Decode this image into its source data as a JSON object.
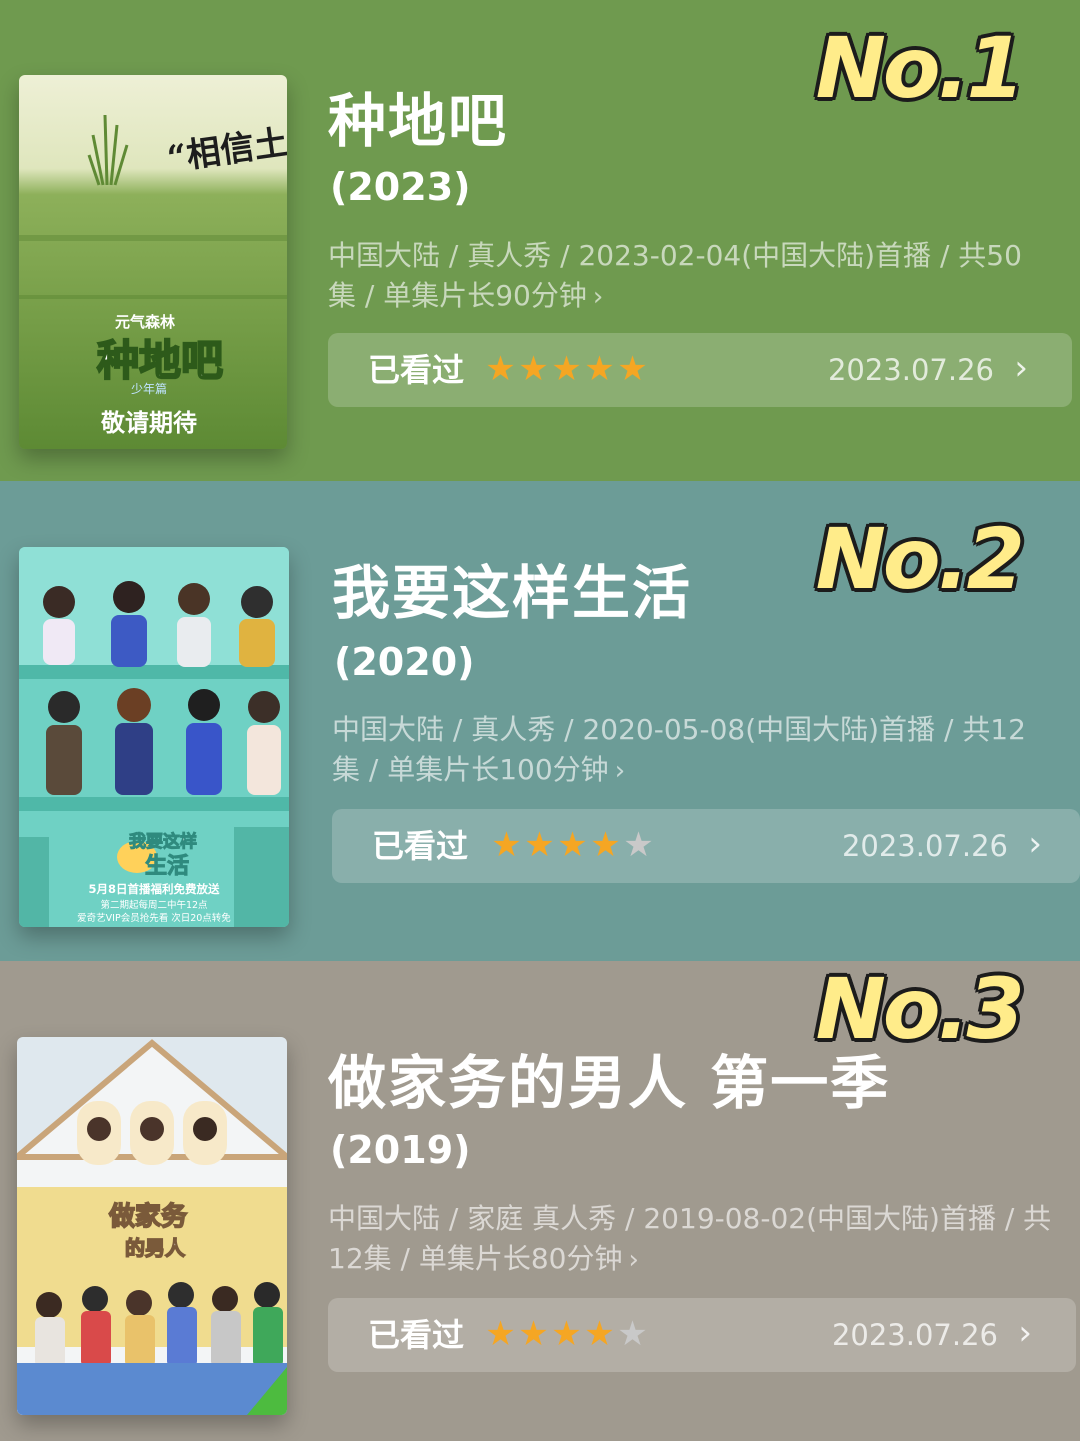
{
  "colors": {
    "section1_bg": "#6f9a4f",
    "section2_bg": "#6c9c97",
    "section3_bg": "#a09a8f",
    "rank_fill": "#ffec8a",
    "star_filled": "#f5a623",
    "star_empty": "#c9c9c9"
  },
  "items": [
    {
      "rank": "No.1",
      "title": "种地吧",
      "year": "(2023)",
      "meta": "中国大陆 / 真人秀 / 2023-02-04(中国大陆)首播 / 共50集 / 单集片长90分钟",
      "watched_label": "已看过",
      "rating": 5,
      "rating_max": 5,
      "date": "2023.07.26",
      "poster": {
        "quote": "“相信土地的力量”",
        "brand": "元气森林",
        "name": "种地吧",
        "sub": "少年篇",
        "tagline": "敬请期待"
      }
    },
    {
      "rank": "No.2",
      "title": "我要这样生活",
      "year": "(2020)",
      "meta": "中国大陆 / 真人秀 / 2020-05-08(中国大陆)首播 / 共12集 / 单集片长100分钟",
      "watched_label": "已看过",
      "rating": 4,
      "rating_max": 5,
      "date": "2023.07.26",
      "poster": {
        "name_line1": "我要这样",
        "name_line2": "生活",
        "line1": "5月8日首播福利免费放送",
        "line2": "第二期起每周二中午12点",
        "line3": "爱奇艺VIP会员抢先看 次日20点转免"
      }
    },
    {
      "rank": "No.3",
      "title": "做家务的男人 第一季",
      "year": "(2019)",
      "meta": "中国大陆 / 家庭 真人秀 / 2019-08-02(中国大陆)首播 / 共12集 / 单集片长80分钟",
      "watched_label": "已看过",
      "rating": 4,
      "rating_max": 5,
      "date": "2023.07.26",
      "poster": {
        "name_line1": "做家务",
        "name_line2": "的男人"
      }
    }
  ]
}
